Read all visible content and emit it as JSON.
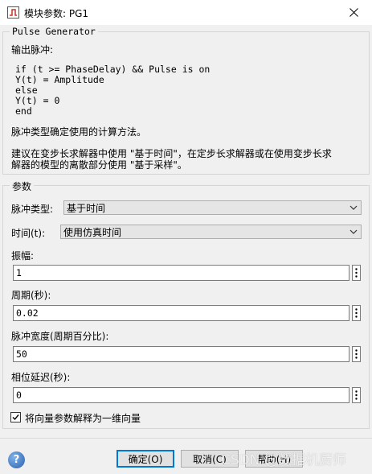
{
  "window": {
    "title": "模块参数: PG1",
    "close_icon": "close-icon"
  },
  "description": {
    "legend": "Pulse Generator",
    "subtitle": "输出脉冲:",
    "code_lines": [
      "if (t >= PhaseDelay) && Pulse is on",
      "Y(t) = Amplitude",
      "else",
      "Y(t) = 0",
      "end"
    ],
    "para1": "脉冲类型确定使用的计算方法。",
    "para2_line1": "建议在变步长求解器中使用 \"基于时间\"，在定步长求解器或在使用变步长求",
    "para2_line2": "解器的模型的离散部分使用 \"基于采样\"。"
  },
  "params": {
    "legend": "参数",
    "pulse_type_label": "脉冲类型:",
    "pulse_type_value": "基于时间",
    "time_label": "时间(t):",
    "time_value": "使用仿真时间",
    "amplitude_label": "振幅:",
    "amplitude_value": "1",
    "period_label": "周期(秒):",
    "period_value": "0.02",
    "pulse_width_label": "脉冲宽度(周期百分比):",
    "pulse_width_value": "50",
    "phase_delay_label": "相位延迟(秒):",
    "phase_delay_value": "0",
    "vector_checkbox_label": "将向量参数解释为一维向量",
    "vector_checkbox_checked": true
  },
  "footer": {
    "help_label": "?",
    "ok_label": "确定(O)",
    "cancel_label": "取消(C)",
    "help_button_label": "帮助(H)",
    "watermark": "CSDN @数据机厨师"
  }
}
